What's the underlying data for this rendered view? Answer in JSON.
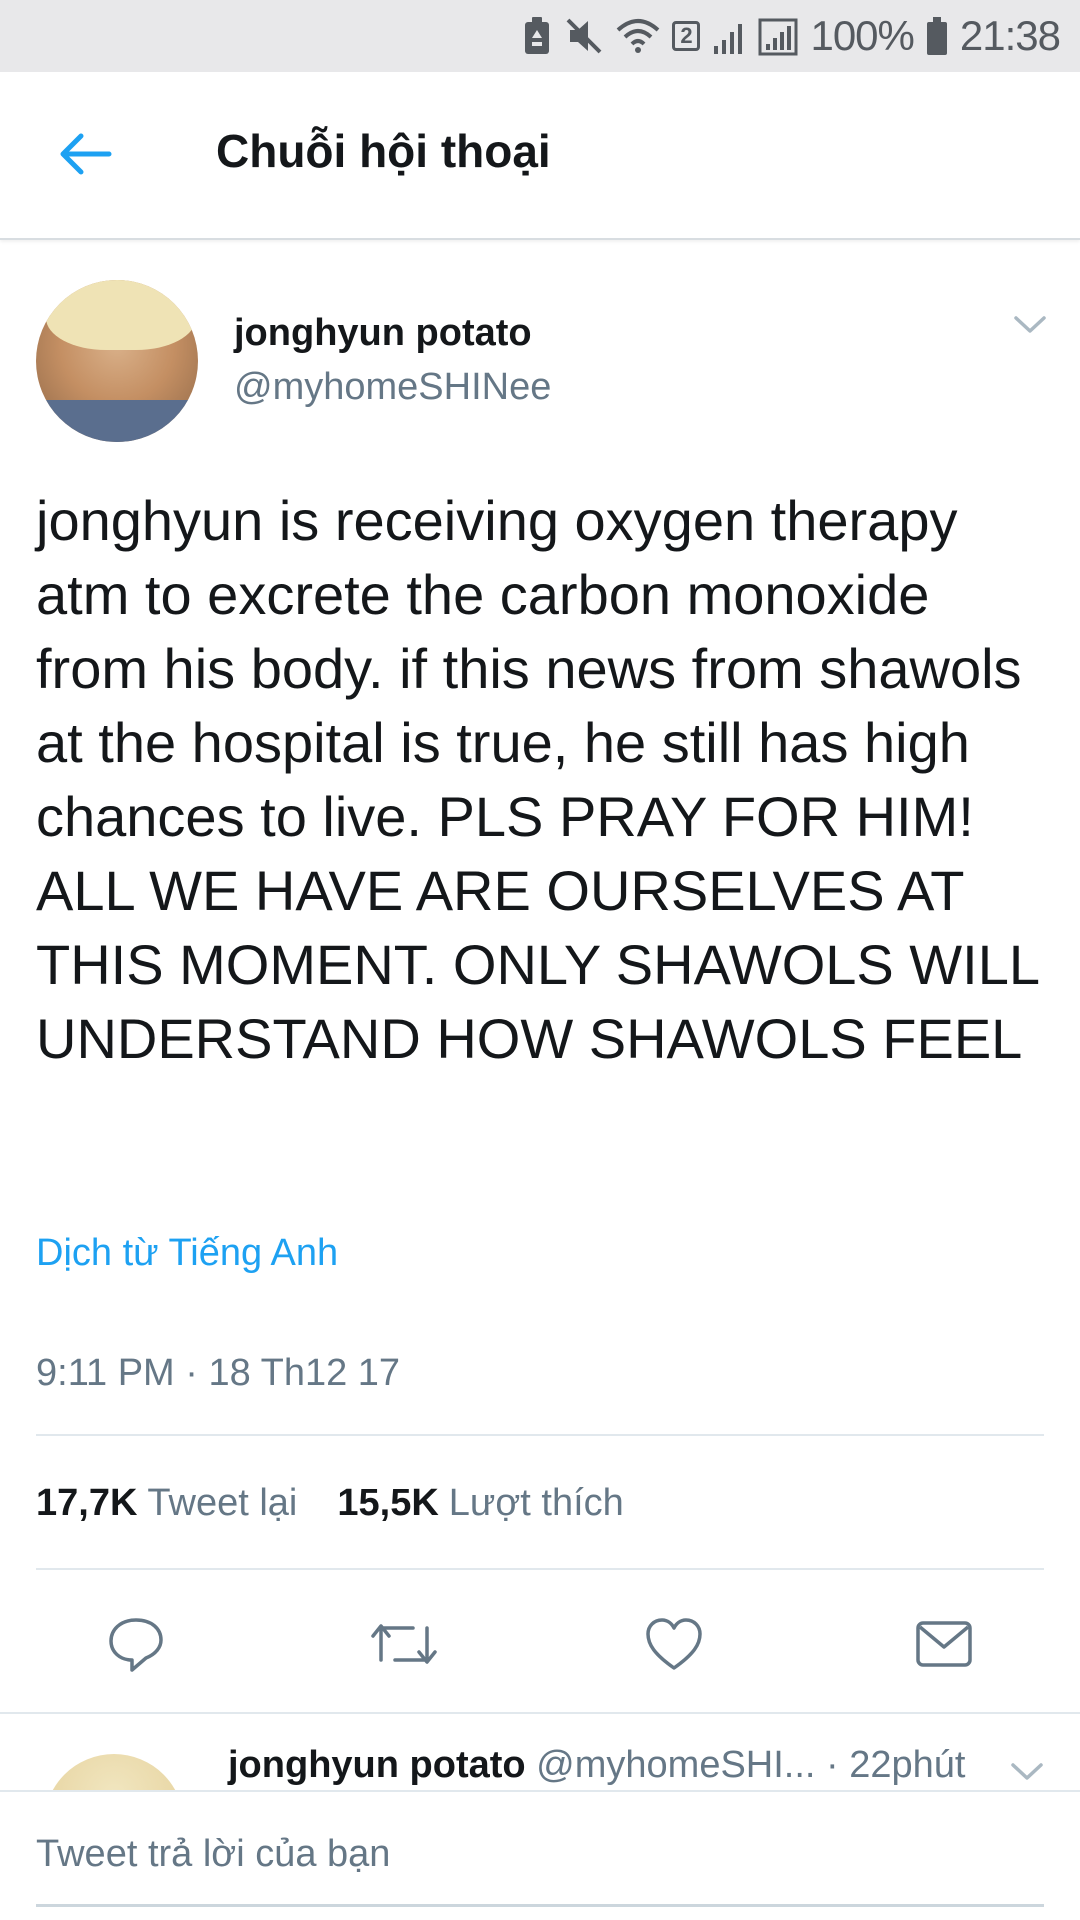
{
  "status_bar": {
    "battery_percent": "100%",
    "time": "21:38",
    "sim_badge": "2",
    "icons": [
      "battery-saver-icon",
      "mute-icon",
      "wifi-icon",
      "signal-icon",
      "signal-icon",
      "battery-icon"
    ]
  },
  "header": {
    "title": "Chuỗi hội thoại",
    "back_icon": "arrow-left-icon"
  },
  "tweet": {
    "author_name": "jonghyun potato",
    "author_handle": "@myhomeSHINee",
    "text": "jonghyun is receiving oxygen therapy atm to excrete the carbon monoxide from his body. if this news from shawols at the hospital is true, he still has high chances to live. PLS PRAY FOR HIM! ALL WE HAVE ARE OURSELVES AT THIS MOMENT. ONLY SHAWOLS WILL UNDERSTAND HOW SHAWOLS FEEL",
    "translate_label": "Dịch từ Tiếng Anh",
    "timestamp": "9:11 PM · 18 Th12 17",
    "retweet_count": "17,7K",
    "retweet_label": "Tweet lại",
    "like_count": "15,5K",
    "like_label": "Lượt thích"
  },
  "actions": [
    "reply-icon",
    "retweet-icon",
    "like-icon",
    "share-icon"
  ],
  "next_reply": {
    "author_name": "jonghyun potato",
    "author_handle": "@myhomeSHI...",
    "time_ago": "· 22phút"
  },
  "composer": {
    "placeholder": "Tweet trả lời của bạn"
  },
  "colors": {
    "accent": "#1da1f2",
    "secondary_text": "#657786",
    "primary_text": "#14171a",
    "status_bar_bg": "#e8e8ea"
  }
}
